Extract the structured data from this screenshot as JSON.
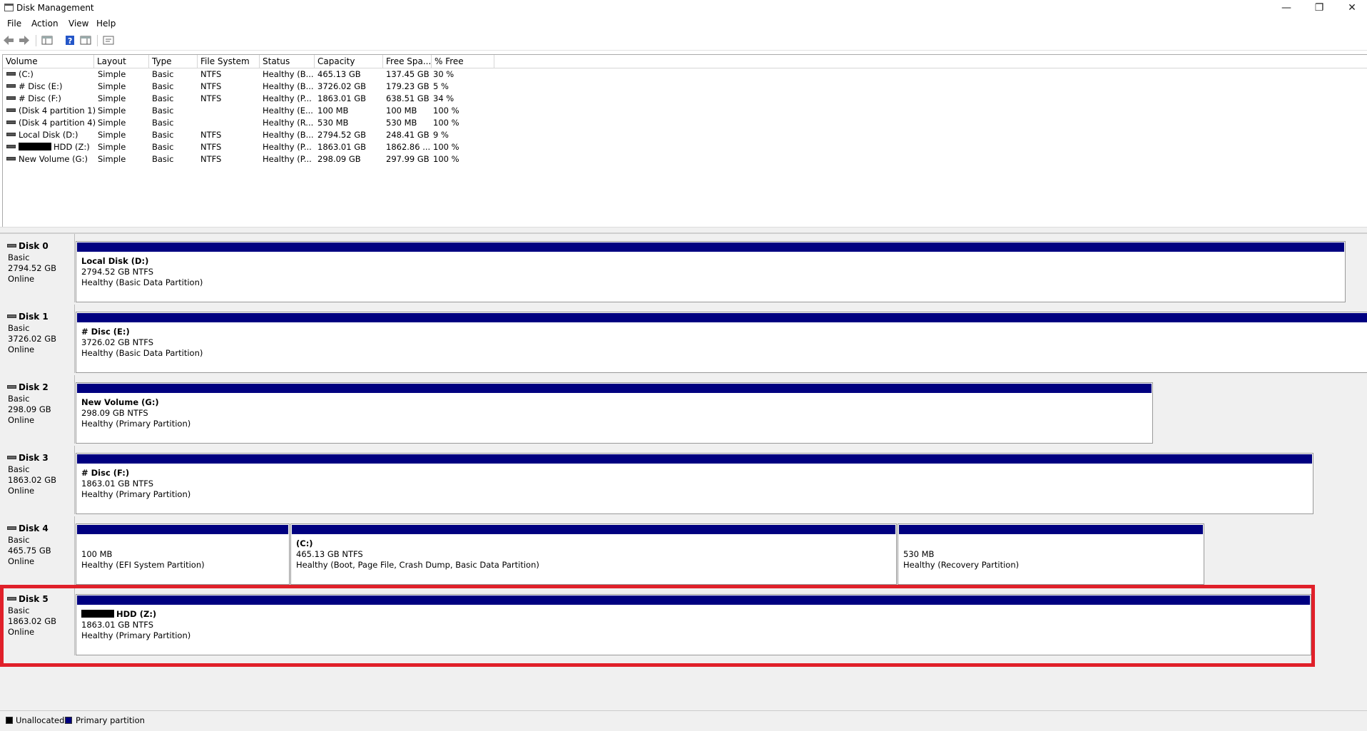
{
  "window": {
    "title": "Disk Management",
    "controls": [
      "—",
      "❐",
      "✕"
    ]
  },
  "menu": [
    "File",
    "Action",
    "View",
    "Help"
  ],
  "toolbar": [
    "back-icon",
    "forward-icon",
    "console-tree-icon",
    "help-icon",
    "properties-icon",
    "settings-icon"
  ],
  "volume_list": {
    "columns": [
      "Volume",
      "Layout",
      "Type",
      "File System",
      "Status",
      "Capacity",
      "Free Spa...",
      "% Free"
    ],
    "rows": [
      {
        "volume": "(C:)",
        "layout": "Simple",
        "type": "Basic",
        "fs": "NTFS",
        "status": "Healthy (B...",
        "capacity": "465.13 GB",
        "free": "137.45 GB",
        "pct": "30 %",
        "redacted": false
      },
      {
        "volume": "# Disc (E:)",
        "layout": "Simple",
        "type": "Basic",
        "fs": "NTFS",
        "status": "Healthy (B...",
        "capacity": "3726.02 GB",
        "free": "179.23 GB",
        "pct": "5 %",
        "redacted": false
      },
      {
        "volume": "# Disc (F:)",
        "layout": "Simple",
        "type": "Basic",
        "fs": "NTFS",
        "status": "Healthy (P...",
        "capacity": "1863.01 GB",
        "free": "638.51 GB",
        "pct": "34 %",
        "redacted": false
      },
      {
        "volume": "(Disk 4 partition 1)",
        "layout": "Simple",
        "type": "Basic",
        "fs": "",
        "status": "Healthy (E...",
        "capacity": "100 MB",
        "free": "100 MB",
        "pct": "100 %",
        "redacted": false
      },
      {
        "volume": "(Disk 4 partition 4)",
        "layout": "Simple",
        "type": "Basic",
        "fs": "",
        "status": "Healthy (R...",
        "capacity": "530 MB",
        "free": "530 MB",
        "pct": "100 %",
        "redacted": false
      },
      {
        "volume": "Local Disk (D:)",
        "layout": "Simple",
        "type": "Basic",
        "fs": "NTFS",
        "status": "Healthy (B...",
        "capacity": "2794.52 GB",
        "free": "248.41 GB",
        "pct": "9 %",
        "redacted": false
      },
      {
        "volume": "HDD (Z:)",
        "layout": "Simple",
        "type": "Basic",
        "fs": "NTFS",
        "status": "Healthy (P...",
        "capacity": "1863.01 GB",
        "free": "1862.86 ...",
        "pct": "100 %",
        "redacted": true
      },
      {
        "volume": "New Volume (G:)",
        "layout": "Simple",
        "type": "Basic",
        "fs": "NTFS",
        "status": "Healthy (P...",
        "capacity": "298.09 GB",
        "free": "297.99 GB",
        "pct": "100 %",
        "redacted": false
      }
    ]
  },
  "disks": [
    {
      "name": "Disk 0",
      "type": "Basic",
      "size": "2794.52 GB",
      "state": "Online",
      "partitions": [
        {
          "name": "Local Disk  (D:)",
          "detail": "2794.52 GB NTFS",
          "status": "Healthy (Basic Data Partition)",
          "redacted": false
        }
      ]
    },
    {
      "name": "Disk 1",
      "type": "Basic",
      "size": "3726.02 GB",
      "state": "Online",
      "partitions": [
        {
          "name": "# Disc  (E:)",
          "detail": "3726.02 GB NTFS",
          "status": "Healthy (Basic Data Partition)",
          "redacted": false
        }
      ]
    },
    {
      "name": "Disk 2",
      "type": "Basic",
      "size": "298.09 GB",
      "state": "Online",
      "partitions": [
        {
          "name": "New Volume  (G:)",
          "detail": "298.09 GB NTFS",
          "status": "Healthy (Primary Partition)",
          "redacted": false
        }
      ]
    },
    {
      "name": "Disk 3",
      "type": "Basic",
      "size": "1863.02 GB",
      "state": "Online",
      "partitions": [
        {
          "name": "# Disc  (F:)",
          "detail": "1863.01 GB NTFS",
          "status": "Healthy (Primary Partition)",
          "redacted": false
        }
      ]
    },
    {
      "name": "Disk 4",
      "type": "Basic",
      "size": "465.75 GB",
      "state": "Online",
      "partitions": [
        {
          "name": "",
          "detail": "100 MB",
          "status": "Healthy (EFI System Partition)",
          "redacted": false
        },
        {
          "name": " (C:)",
          "detail": "465.13 GB NTFS",
          "status": "Healthy (Boot, Page File, Crash Dump, Basic Data Partition)",
          "redacted": false
        },
        {
          "name": "",
          "detail": "530 MB",
          "status": "Healthy (Recovery Partition)",
          "redacted": false
        }
      ]
    },
    {
      "name": "Disk 5",
      "type": "Basic",
      "size": "1863.02 GB",
      "state": "Online",
      "partitions": [
        {
          "name": "HDD  (Z:)",
          "detail": "1863.01 GB NTFS",
          "status": "Healthy (Primary Partition)",
          "redacted": true
        }
      ]
    }
  ],
  "legend": [
    {
      "label": "Unallocated",
      "color": "#000000"
    },
    {
      "label": "Primary partition",
      "color": "#000080"
    }
  ],
  "colors": {
    "partition_bar": "#000080",
    "highlight": "#e0202a"
  }
}
